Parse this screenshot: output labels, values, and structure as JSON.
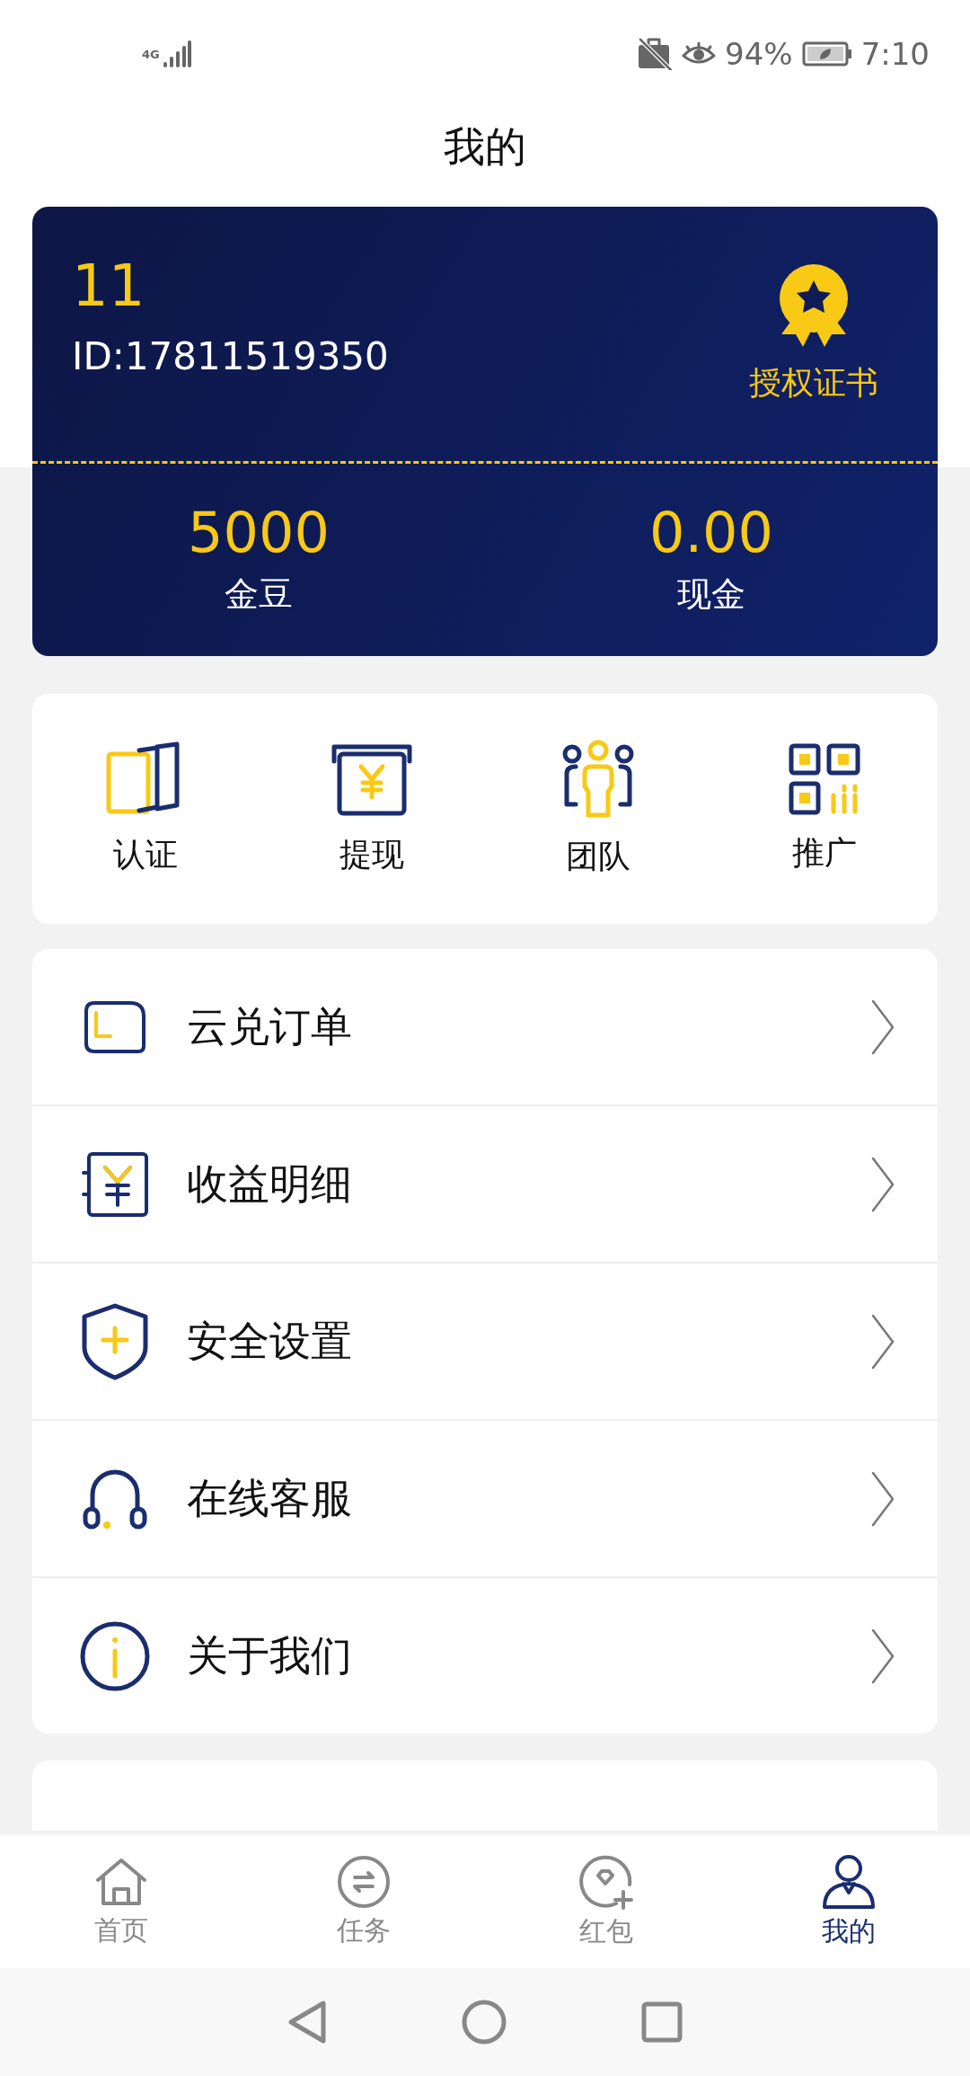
{
  "status_bar": {
    "network": "4G",
    "battery": "94%",
    "time": "7:10"
  },
  "title": "我的",
  "profile": {
    "name": "11",
    "id": "ID:17811519350",
    "certificate": "授权证书",
    "balances": [
      {
        "value": "5000",
        "label": "金豆"
      },
      {
        "value": "0.00",
        "label": "现金"
      }
    ]
  },
  "shortcuts": [
    {
      "kind": "cards",
      "label": "认证"
    },
    {
      "kind": "withdraw",
      "label": "提现"
    },
    {
      "kind": "team",
      "label": "团队"
    },
    {
      "kind": "qr",
      "label": "推广"
    }
  ],
  "menu": [
    {
      "kind": "order",
      "label": "云兑订单"
    },
    {
      "kind": "income",
      "label": "收益明细"
    },
    {
      "kind": "shield",
      "label": "安全设置"
    },
    {
      "kind": "headset",
      "label": "在线客服"
    },
    {
      "kind": "info",
      "label": "关于我们"
    }
  ],
  "tabs": [
    {
      "kind": "home",
      "label": "首页",
      "selected": false
    },
    {
      "kind": "task",
      "label": "任务",
      "selected": false
    },
    {
      "kind": "gift",
      "label": "红包",
      "selected": false
    },
    {
      "kind": "me",
      "label": "我的",
      "selected": true
    }
  ]
}
